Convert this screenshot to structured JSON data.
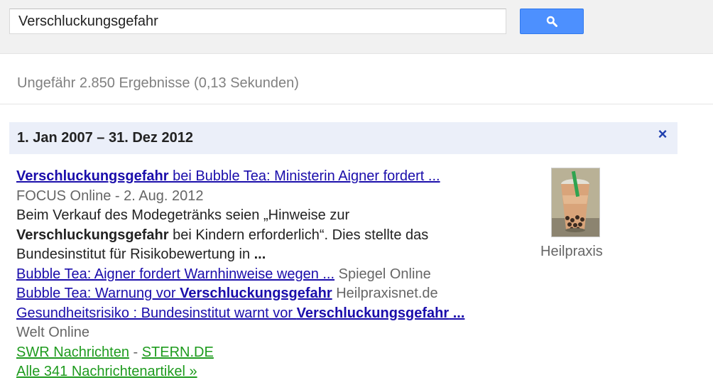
{
  "search": {
    "query": "Verschluckungsgefahr"
  },
  "stats": "Ungefähr 2.850 Ergebnisse (0,13 Sekunden)",
  "date_filter": {
    "label": "1. Jan 2007 – 31. Dez 2012",
    "close_glyph": "×"
  },
  "result": {
    "title": {
      "bold": "Verschluckungsgefahr",
      "rest": " bei Bubble Tea: Ministerin Aigner fordert ..."
    },
    "source": "FOCUS Online - 2. Aug. 2012",
    "snippet": {
      "p1": "Beim Verkauf des Modegetränks seien „Hinweise zur",
      "b1": "Verschluckungsgefahr",
      "p2": " bei Kindern erforderlich“. Dies stellte das",
      "p3": "Bundesinstitut für Risikobewertung in ",
      "ellipsis": "..."
    },
    "related": [
      {
        "link_text": "Bubble Tea: Aigner fordert Warnhinweise wegen ...",
        "source": " Spiegel Online"
      },
      {
        "link_pre": "Bubble Tea: Warnung vor ",
        "link_bold": "Verschluckungsgefahr",
        "source": " Heilpraxisnet.de"
      },
      {
        "link_pre": "Gesundheitsrisiko : Bundesinstitut warnt vor ",
        "link_bold": "Verschluckungsgefahr",
        "link_post": " ...",
        "source": "Welt Online"
      }
    ],
    "more_sources": [
      "SWR Nachrichten",
      "STERN.DE"
    ],
    "more_separator": " - ",
    "all_articles": "Alle 341 Nachrichtenartikel »"
  },
  "thumbnail": {
    "caption": "Heilpraxis"
  }
}
